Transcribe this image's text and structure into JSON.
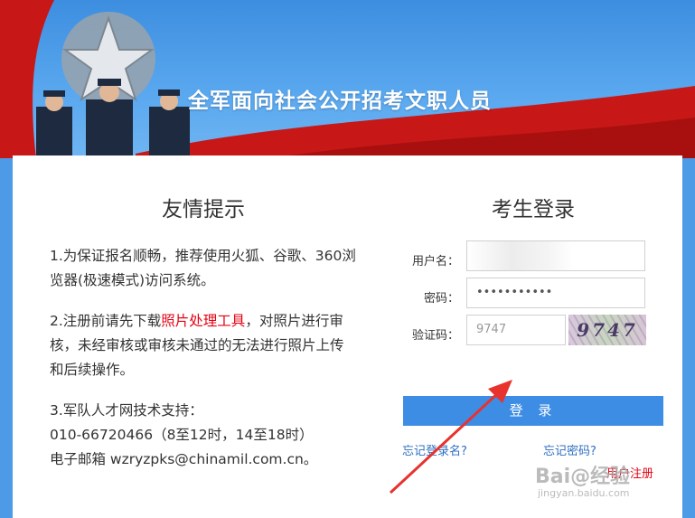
{
  "banner": {
    "title": "全军面向社会公开招考文职人员",
    "emblem": "star-emblem-icon"
  },
  "tips": {
    "title": "友情提示",
    "item1": "1.为保证报名顺畅，推荐使用火狐、谷歌、360浏览器(极速模式)访问系统。",
    "item2_before": "2.注册前请先下载",
    "item2_link": "照片处理工具",
    "item2_after": "，对照片进行审核，未经审核或审核未通过的无法进行照片上传和后续操作。",
    "item3_line1": "3.军队人才网技术支持：",
    "item3_line2": "010-66720466（8至12时，14至18时）",
    "item3_line3": "电子邮箱 wzryzpks@chinamil.com.cn。"
  },
  "login": {
    "title": "考生登录",
    "username_label": "用户名：",
    "username_value": "",
    "password_label": "密码：",
    "password_value": "•••••••••••",
    "captcha_label": "验证码：",
    "captcha_input_value": "9747",
    "captcha_image_text": "9747",
    "submit_label": "登 录",
    "forgot_username": "忘记登录名?",
    "forgot_password": "忘记密码?",
    "register": "用户注册"
  },
  "watermark": {
    "main": "Bai@经验",
    "sub": "jingyan.baidu.com"
  },
  "colors": {
    "accent_blue": "#3d8de4",
    "link_red": "#e60012",
    "link_blue": "#2e6fc2",
    "annotation_arrow": "#e8322e"
  }
}
